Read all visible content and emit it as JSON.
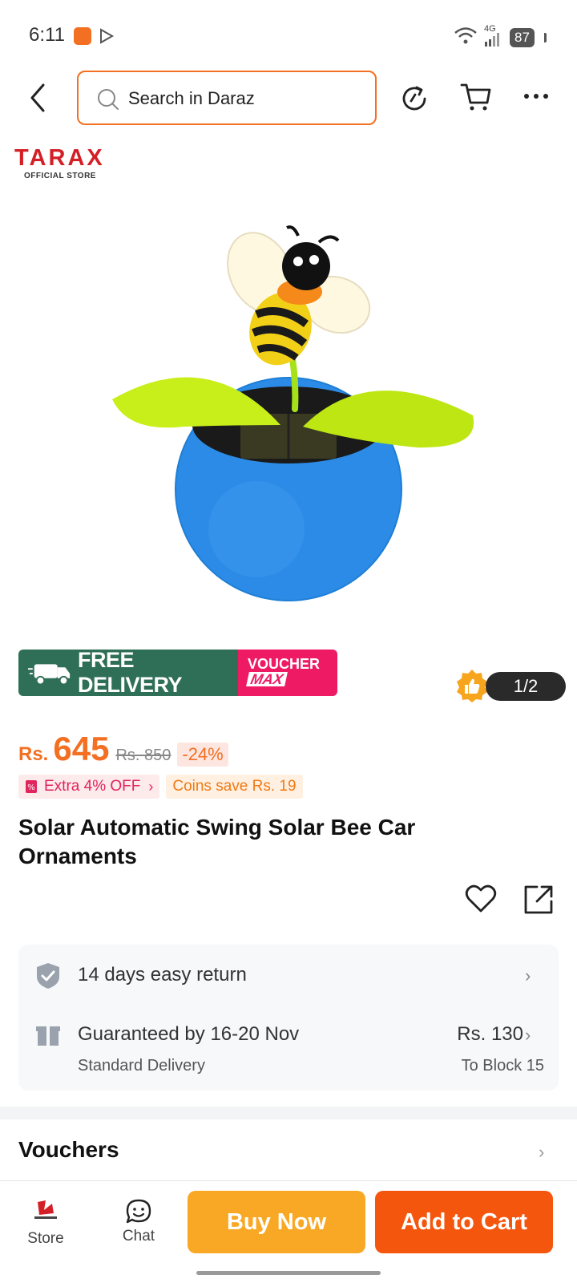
{
  "status_bar": {
    "time": "6:11",
    "network": "4G",
    "battery": "87"
  },
  "search": {
    "placeholder": "Search in Daraz"
  },
  "store": {
    "logo_title": "TARAX",
    "logo_subtitle": "OFFICIAL STORE"
  },
  "gallery": {
    "counter": "1/2"
  },
  "promo": {
    "free_delivery": "FREE DELIVERY",
    "voucher_line1": "VOUCHER",
    "voucher_line2": "MAX"
  },
  "price": {
    "currency": "Rs.",
    "current": "645",
    "original": "Rs. 850",
    "discount": "-24%"
  },
  "tags": {
    "extra_off": "Extra 4% OFF",
    "coins": "Coins save Rs. 19"
  },
  "product": {
    "title": "Solar Automatic Swing Solar Bee Car Ornaments"
  },
  "services": {
    "return": "14 days easy return",
    "delivery_title": "Guaranteed by 16-20 Nov",
    "delivery_type": "Standard Delivery",
    "delivery_price": "Rs. 130",
    "delivery_destination": "To Block 15"
  },
  "vouchers": {
    "title": "Vouchers"
  },
  "bottom_bar": {
    "store_label": "Store",
    "chat_label": "Chat",
    "buy_now": "Buy Now",
    "add_to_cart": "Add to Cart"
  },
  "colors": {
    "accent": "#f36f21",
    "buy_now": "#f9a825",
    "add_to_cart": "#f5560d",
    "free_delivery": "#2f6f58",
    "voucher": "#ee1a64"
  }
}
